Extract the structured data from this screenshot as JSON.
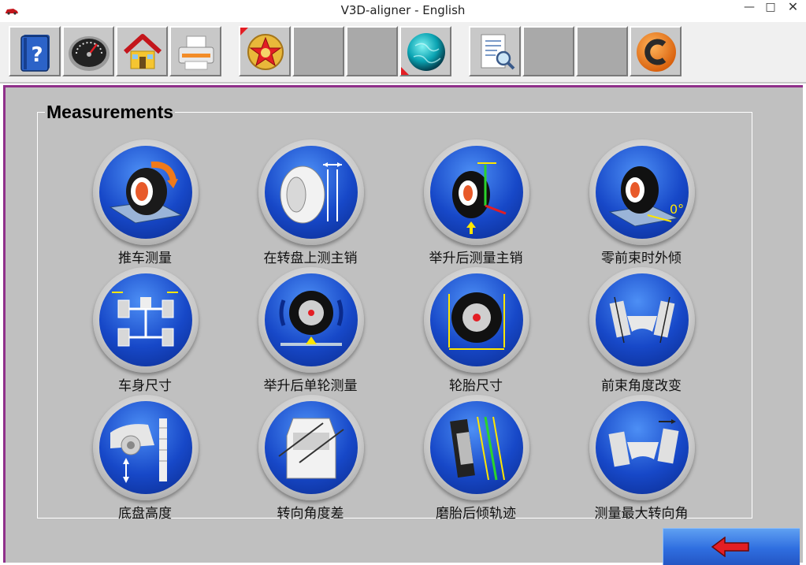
{
  "window": {
    "title": "V3D-aligner - English",
    "controls": {
      "minimize": "—",
      "maximize": "□",
      "close": "✕"
    }
  },
  "toolbar": {
    "buttons": [
      {
        "id": "help",
        "icon": "help-book-icon"
      },
      {
        "id": "dashboard",
        "icon": "speedometer-icon"
      },
      {
        "id": "home",
        "icon": "home-icon"
      },
      {
        "id": "print",
        "icon": "printer-icon"
      },
      {
        "id": "badge",
        "icon": "star-badge-icon"
      },
      {
        "id": "blank1",
        "icon": ""
      },
      {
        "id": "blank2",
        "icon": ""
      },
      {
        "id": "globe",
        "icon": "globe-icon"
      },
      {
        "id": "report",
        "icon": "report-search-icon"
      },
      {
        "id": "blank3",
        "icon": ""
      },
      {
        "id": "blank4",
        "icon": ""
      },
      {
        "id": "c-logo",
        "icon": "c-logo-icon"
      }
    ]
  },
  "measurements": {
    "title": "Measurements",
    "items": [
      {
        "label": "推车测量",
        "icon": "push-car-measure-icon"
      },
      {
        "label": "在转盘上测主销",
        "icon": "turntable-kingpin-icon"
      },
      {
        "label": "举升后测量主销",
        "icon": "lifted-kingpin-icon"
      },
      {
        "label": "零前束时外倾",
        "icon": "zero-toe-camber-icon"
      },
      {
        "label": "车身尺寸",
        "icon": "body-dimension-icon"
      },
      {
        "label": "举升后单轮测量",
        "icon": "lifted-single-wheel-icon"
      },
      {
        "label": "轮胎尺寸",
        "icon": "tire-size-icon"
      },
      {
        "label": "前束角度改变",
        "icon": "toe-change-icon"
      },
      {
        "label": "底盘高度",
        "icon": "ride-height-icon"
      },
      {
        "label": "转向角度差",
        "icon": "steering-angle-diff-icon"
      },
      {
        "label": "磨胎后倾轨迹",
        "icon": "runout-caster-trace-icon"
      },
      {
        "label": "测量最大转向角",
        "icon": "max-steer-angle-icon"
      }
    ]
  },
  "colors": {
    "accent_frame": "#8f2f8a",
    "tile_blue": "#1748c8",
    "back_button": "#2f6ee0",
    "back_arrow": "#e31e24"
  },
  "back_button": {
    "icon": "back-arrow-icon"
  }
}
